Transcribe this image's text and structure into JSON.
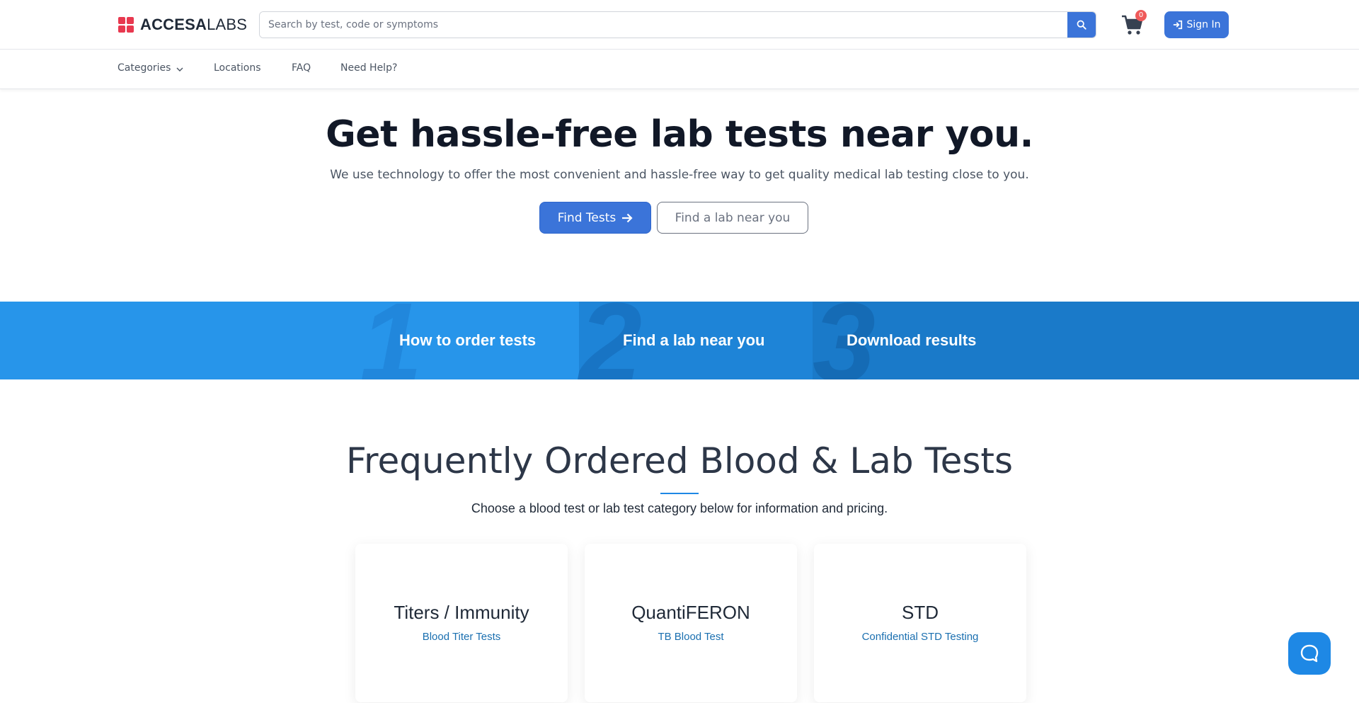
{
  "header": {
    "logo": {
      "bold": "ACCESA",
      "light": "LABS"
    },
    "search": {
      "placeholder": "Search by test, code or symptoms",
      "value": ""
    },
    "cart": {
      "count": "0",
      "icon": "cart-icon"
    },
    "signin_label": "Sign In"
  },
  "nav": {
    "items": [
      {
        "label": "Categories"
      },
      {
        "label": "Locations"
      },
      {
        "label": "FAQ"
      },
      {
        "label": "Need Help?"
      }
    ]
  },
  "hero": {
    "title": "Get hassle-free lab tests near you.",
    "subtitle": "We use technology to offer the most convenient and hassle-free way to get quality medical lab testing close to you.",
    "primary_button": "Find Tests",
    "secondary_button": "Find a lab near you"
  },
  "steps": [
    {
      "number": "1",
      "label": "How to order tests"
    },
    {
      "number": "2",
      "label": "Find a lab near you"
    },
    {
      "number": "3",
      "label": "Download results"
    }
  ],
  "frequent": {
    "title": "Frequently Ordered Blood & Lab Tests",
    "subtitle": "Choose a blood test or lab test category below for information and pricing.",
    "cards": [
      {
        "title": "Titers / Immunity",
        "link": "Blood Titer Tests"
      },
      {
        "title": "QuantiFERON",
        "link": "TB Blood Test"
      },
      {
        "title": "STD",
        "link": "Confidential STD Testing"
      }
    ]
  },
  "colors": {
    "brand_red": "#e8384f",
    "primary_blue": "#3b74d9",
    "step1": "#2795ea",
    "step2": "#1e84d7",
    "step3": "#1a7ac9",
    "chat": "#1e88e5"
  }
}
